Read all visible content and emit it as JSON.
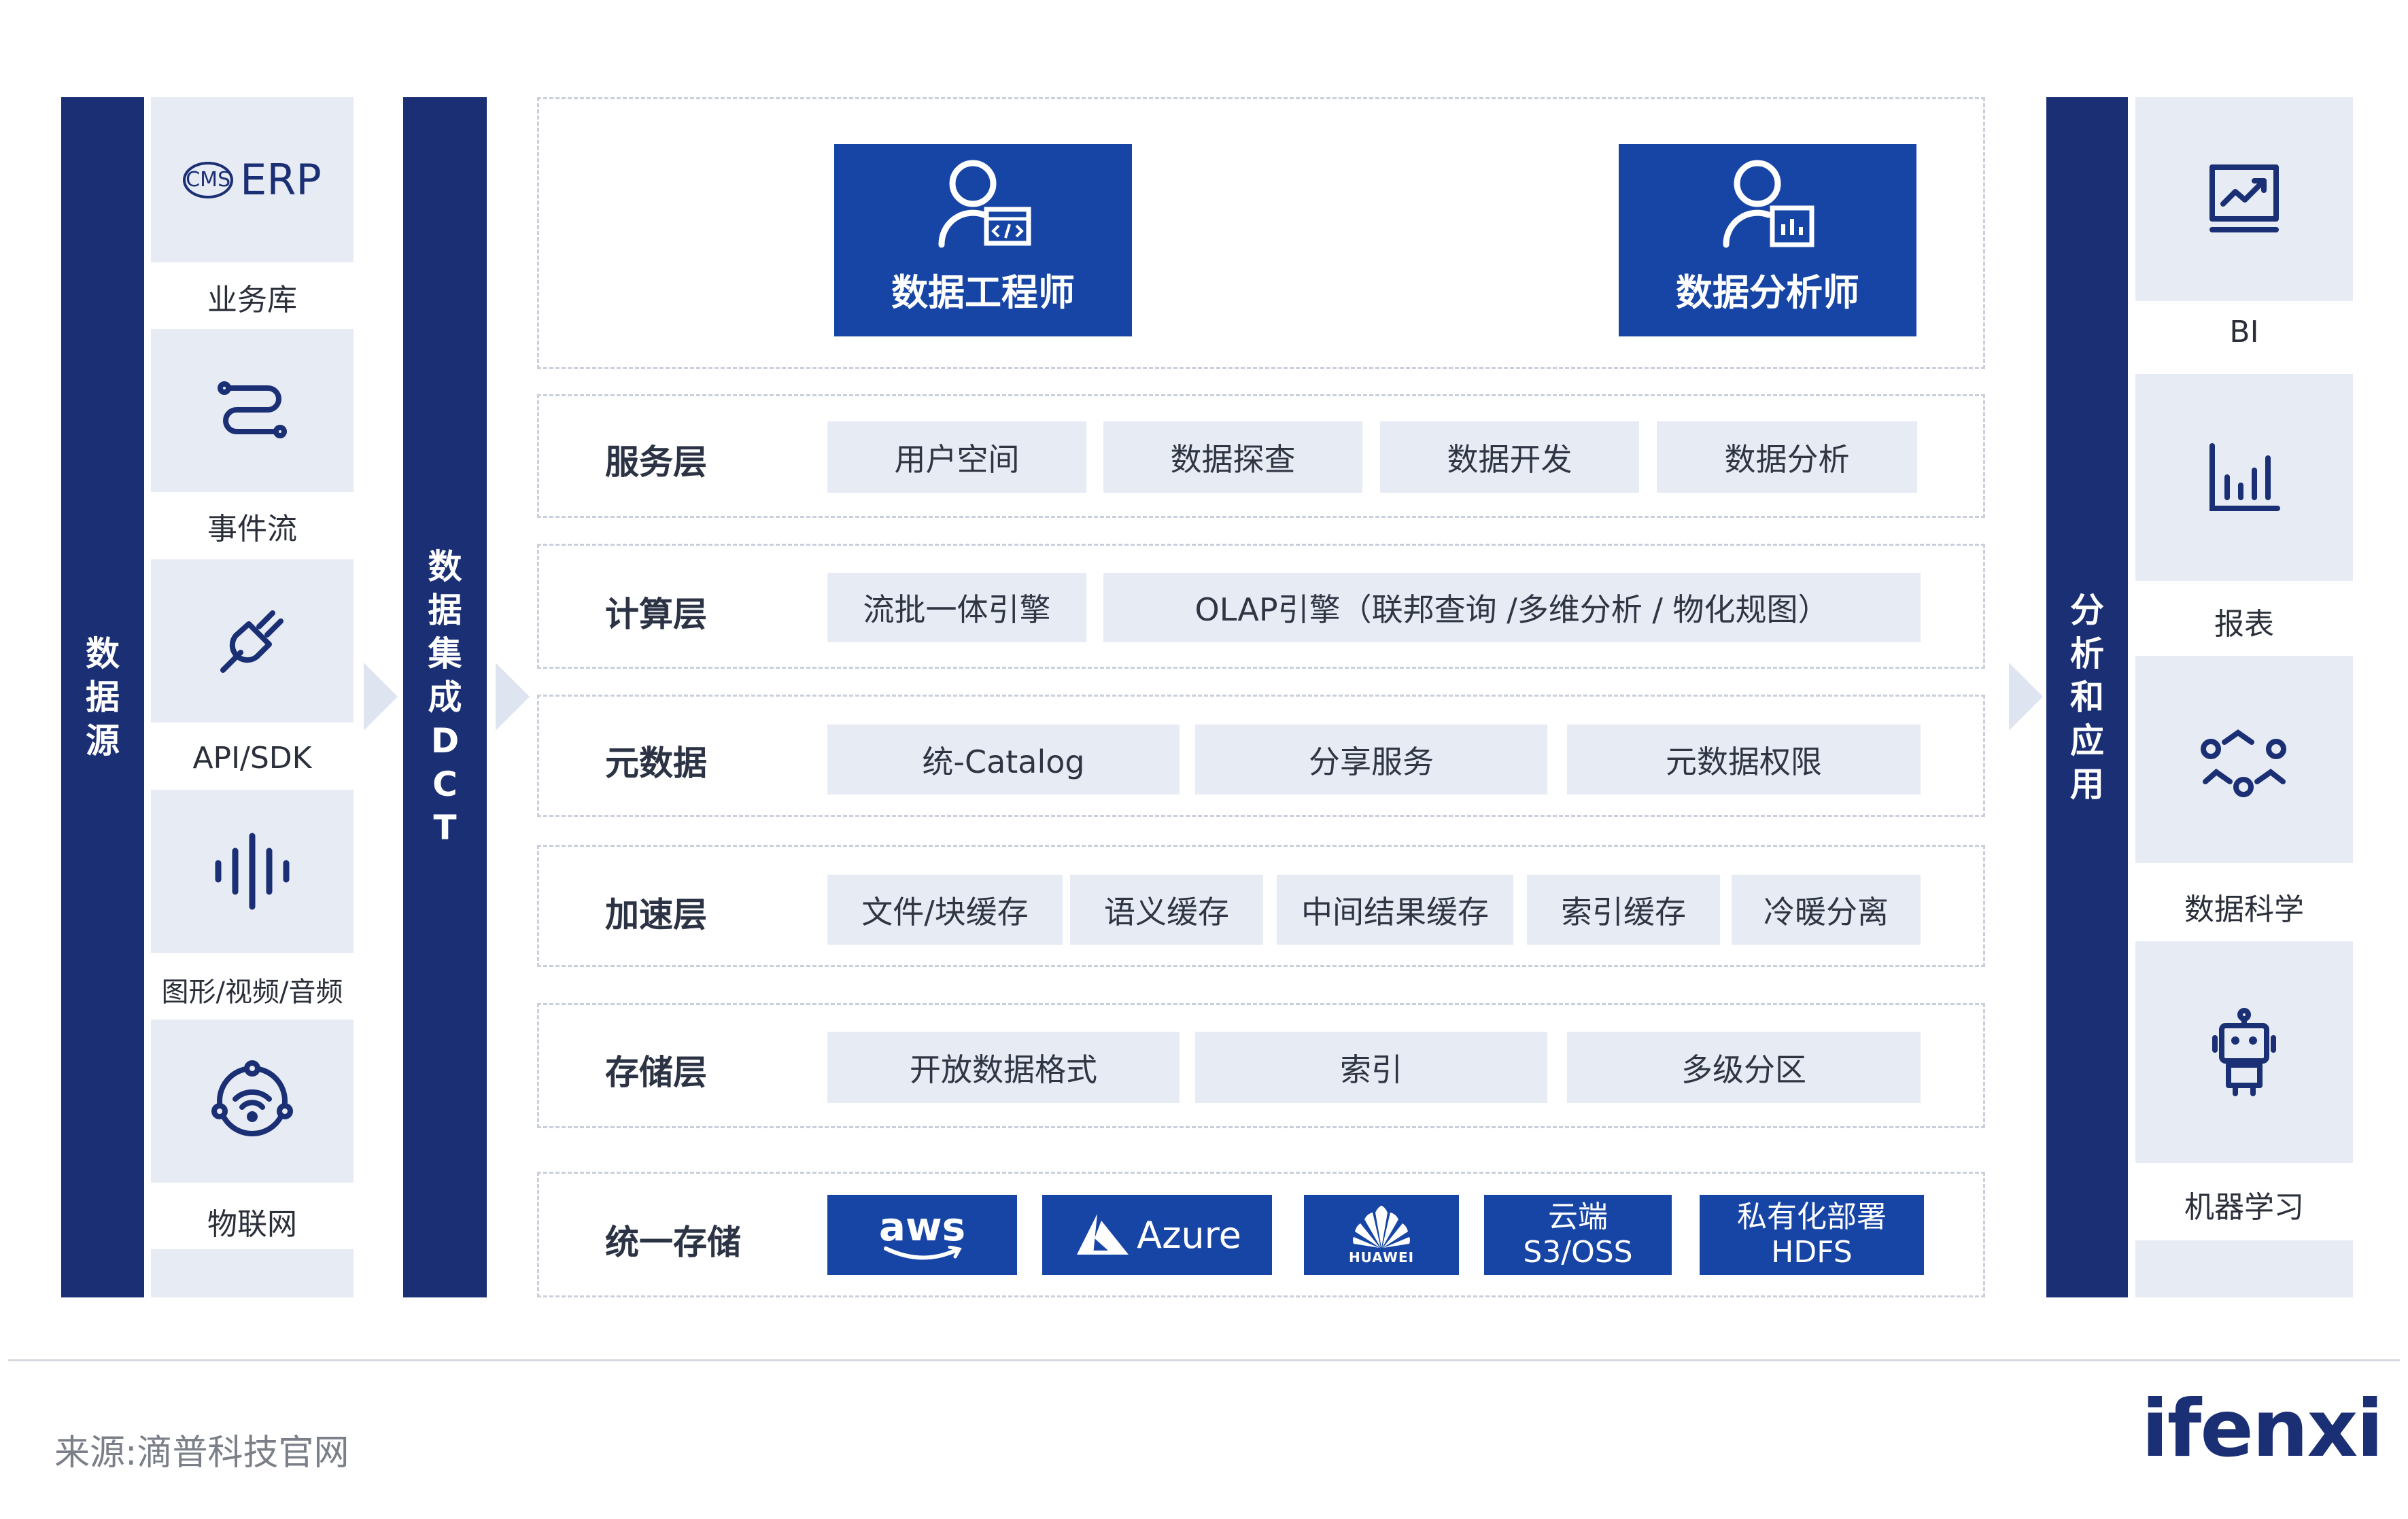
{
  "sources": {
    "title": "数据源",
    "items": [
      {
        "label": "业务库",
        "icon": "cms-erp-icon",
        "logo_text": "ERP",
        "logo_small": "CMS"
      },
      {
        "label": "事件流",
        "icon": "event-stream-icon"
      },
      {
        "label": "API/SDK",
        "icon": "plug-icon"
      },
      {
        "label": "图形/视频/音频",
        "icon": "audio-wave-icon"
      },
      {
        "label": "物联网",
        "icon": "iot-icon"
      }
    ]
  },
  "integration": {
    "title": "数据集成DCT",
    "chars": [
      "数",
      "据",
      "集",
      "成",
      "D",
      "C",
      "T"
    ]
  },
  "roles": [
    {
      "label": "数据工程师",
      "icon": "engineer-icon"
    },
    {
      "label": "数据分析师",
      "icon": "analyst-icon"
    }
  ],
  "layers": [
    {
      "title": "服务层",
      "cells": [
        "用户空间",
        "数据探查",
        "数据开发",
        "数据分析"
      ]
    },
    {
      "title": "计算层",
      "cells": [
        "流批一体引擎",
        "OLAP引擎（联邦查询 /多维分析 / 物化规图）"
      ]
    },
    {
      "title": "元数据",
      "cells": [
        "统-Catalog",
        "分享服务",
        "元数据权限"
      ]
    },
    {
      "title": "加速层",
      "cells": [
        "文件/块缓存",
        "语义缓存",
        "中间结果缓存",
        "索引缓存",
        "冷暖分离"
      ]
    },
    {
      "title": "存储层",
      "cells": [
        "开放数据格式",
        "索引",
        "多级分区"
      ]
    }
  ],
  "unified_storage": {
    "title": "统一存储",
    "items": [
      {
        "name": "aws",
        "icon": "aws-logo-icon"
      },
      {
        "name": "Azure",
        "icon": "azure-logo-icon"
      },
      {
        "name": "HUAWEI",
        "icon": "huawei-logo-icon"
      },
      {
        "line1": "云端",
        "line2": "S3/OSS"
      },
      {
        "line1": "私有化部署",
        "line2": "HDFS"
      }
    ]
  },
  "apps": {
    "title": "分析和应用",
    "chars": [
      "分",
      "析",
      "和",
      "应",
      "用"
    ],
    "items": [
      {
        "label": "BI",
        "icon": "bi-report-icon"
      },
      {
        "label": "报表",
        "icon": "bar-chart-icon"
      },
      {
        "label": "数据科学",
        "icon": "data-science-icon"
      },
      {
        "label": "机器学习",
        "icon": "robot-icon"
      }
    ]
  },
  "footer": {
    "source": "来源:滴普科技官网",
    "brand": "ifenxi"
  },
  "colors": {
    "navy": "#1b2f74",
    "blue": "#1745a5",
    "tile": "#e6ebf4"
  }
}
